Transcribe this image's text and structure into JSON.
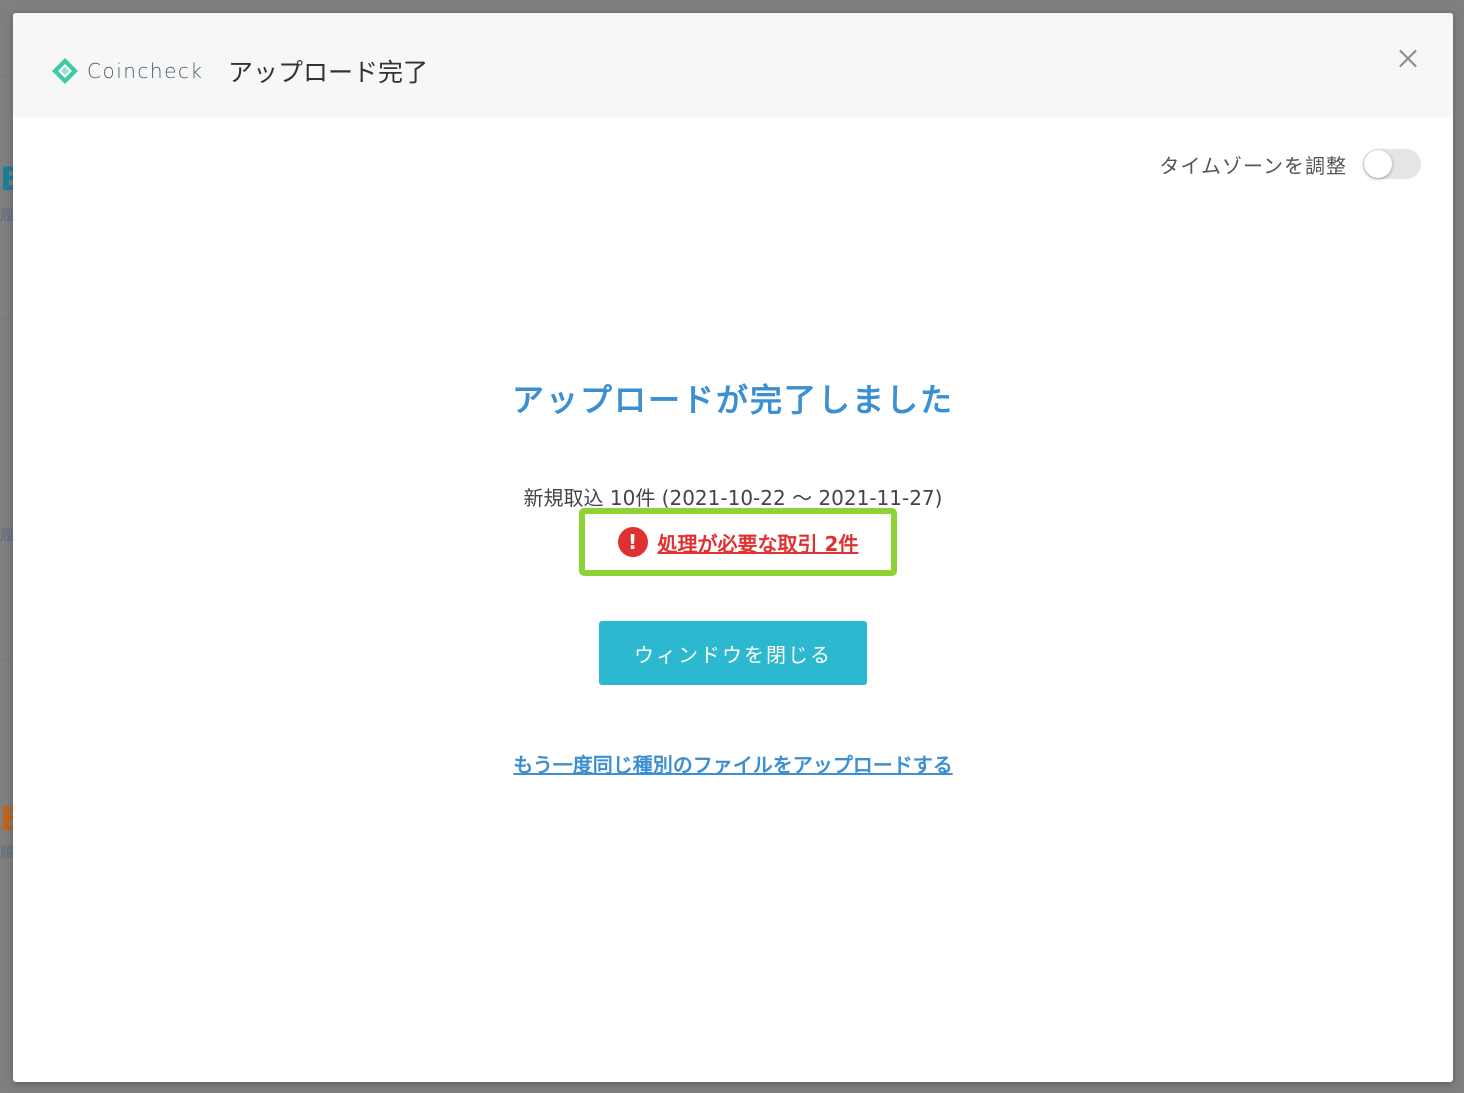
{
  "header": {
    "logo_text": "Coincheck",
    "title": "アップロード完了",
    "close_icon": "close-icon"
  },
  "timezone": {
    "label": "タイムゾーンを調整",
    "enabled": false
  },
  "main": {
    "heading": "アップロードが完了しました",
    "summary": "新規取込 10件 (2021-10-22 〜 2021-11-27)",
    "alert": {
      "icon": "exclamation-icon",
      "text": "処理が必要な取引 2件",
      "color": "#e03131"
    },
    "close_window_label": "ウィンドウを閉じる",
    "reupload_label": "もう一度同じ種別のファイルをアップロードする"
  },
  "colors": {
    "accent_blue": "#3c8fd1",
    "button_teal": "#2cb8cf",
    "highlight_green": "#8fd236",
    "logo_green": "#3ec9a7"
  }
}
